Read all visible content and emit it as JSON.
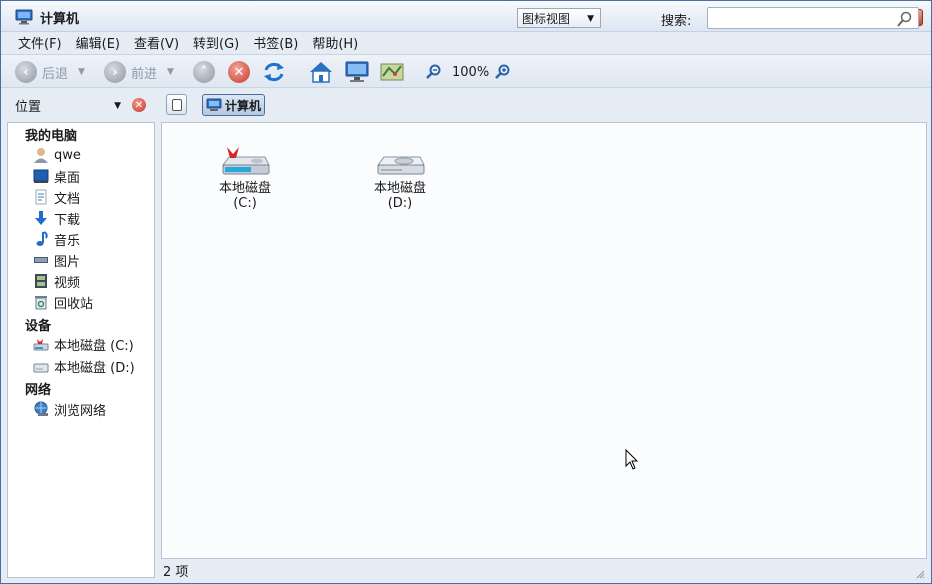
{
  "window": {
    "title": "计算机"
  },
  "menubar": [
    "文件(F)",
    "编辑(E)",
    "查看(V)",
    "转到(G)",
    "书签(B)",
    "帮助(H)"
  ],
  "toolbar": {
    "back_label": "后退",
    "forward_label": "前进",
    "zoom": "100%",
    "view_mode": "图标视图",
    "search_label": "搜索:",
    "search_value": ""
  },
  "location": {
    "place_label": "位置",
    "crumb_label": "计算机"
  },
  "sidebar": {
    "sections": [
      {
        "heading": "我的电脑",
        "items": [
          "qwe",
          "桌面",
          "文档",
          "下载",
          "音乐",
          "图片",
          "视频",
          "回收站"
        ]
      },
      {
        "heading": "设备",
        "items": [
          "本地磁盘 (C:)",
          "本地磁盘 (D:)"
        ]
      },
      {
        "heading": "网络",
        "items": [
          "浏览网络"
        ]
      }
    ]
  },
  "content": {
    "drives": [
      {
        "name": "本地磁盘",
        "letter": "(C:)"
      },
      {
        "name": "本地磁盘",
        "letter": "(D:)"
      }
    ]
  },
  "status": {
    "count": "2 项"
  },
  "colors": {
    "accent": "#4a6fa5",
    "close_red": "#c73328"
  }
}
